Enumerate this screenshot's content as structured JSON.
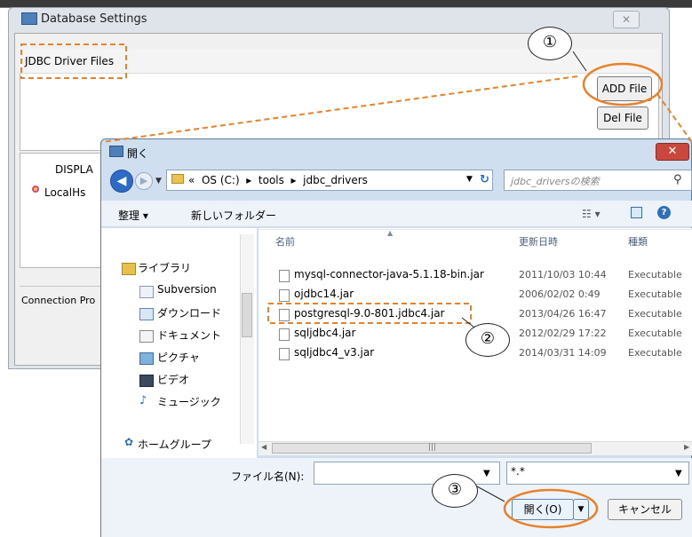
{
  "db_window": {
    "title": "Database Settings",
    "close_glyph": "✕",
    "jdbc_section_label": "JDBC Driver Files",
    "add_file_label": "ADD File",
    "del_file_label": "Del File",
    "table_header": "DISPLA",
    "table_row_1": "LocalHs",
    "connection_label": "Connection Pro"
  },
  "file_dialog": {
    "title": "開く",
    "close_glyph": "✕",
    "address_parts": "«  OS (C:)  ▸  tools  ▸  jdbc_drivers",
    "search_placeholder": "jdbc_driversの検索",
    "toolbar": {
      "organize": "整理 ▾",
      "new_folder": "新しいフォルダー"
    },
    "nav_items": [
      "ライブラリ",
      "Subversion",
      "ダウンロード",
      "ドキュメント",
      "ピクチャ",
      "ビデオ",
      "ミュージック",
      "ホームグループ"
    ],
    "columns": {
      "name": "名前",
      "date": "更新日時",
      "type": "種類"
    },
    "files": [
      {
        "name": "mysql-connector-java-5.1.18-bin.jar",
        "date": "2011/10/03 10:44",
        "type": "Executable"
      },
      {
        "name": "ojdbc14.jar",
        "date": "2006/02/02 0:49",
        "type": "Executable"
      },
      {
        "name": "postgresql-9.0-801.jdbc4.jar",
        "date": "2013/04/26 16:47",
        "type": "Executable"
      },
      {
        "name": "sqljdbc4.jar",
        "date": "2012/02/29 17:22",
        "type": "Executable"
      },
      {
        "name": "sqljdbc4_v3.jar",
        "date": "2014/03/31 14:09",
        "type": "Executable"
      }
    ],
    "filename_label": "ファイル名(N):",
    "filename_value": "",
    "filter_value": "*.*",
    "open_label": "開く(O)",
    "cancel_label": "キャンセル"
  },
  "callouts": [
    "①",
    "②",
    "③"
  ],
  "colors": {
    "highlight_orange": "#e8822a",
    "accent_blue": "#2d6bc7"
  }
}
